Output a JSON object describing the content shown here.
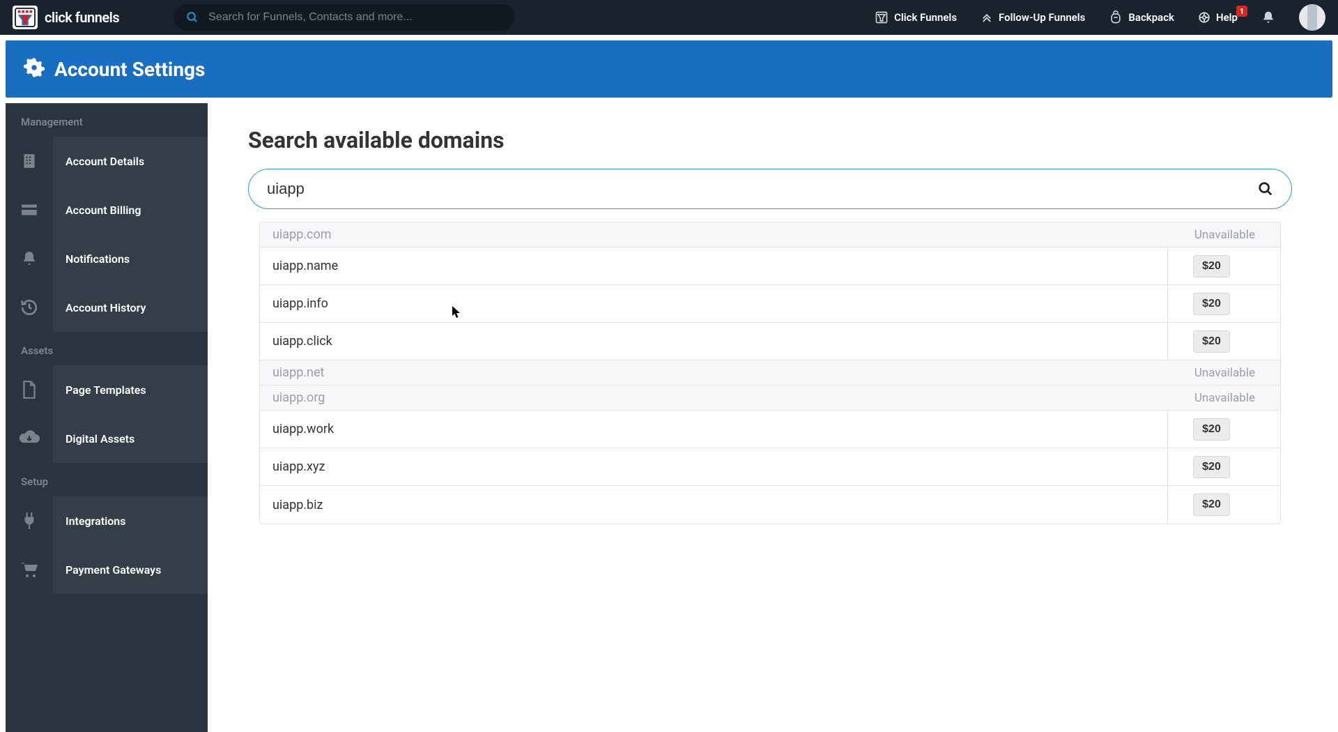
{
  "brand": "click funnels",
  "search_placeholder": "Search for Funnels, Contacts and more...",
  "topnav": [
    {
      "icon": "funnel-icon",
      "label": "Click Funnels"
    },
    {
      "icon": "arrows-up-icon",
      "label": "Follow-Up Funnels"
    },
    {
      "icon": "backpack-icon",
      "label": "Backpack"
    },
    {
      "icon": "help-icon",
      "label": "Help",
      "badge": "1"
    }
  ],
  "page_title": "Account Settings",
  "sidebar": {
    "groups": [
      {
        "title": "Management",
        "items": [
          {
            "icon": "building-icon",
            "label": "Account Details"
          },
          {
            "icon": "card-icon",
            "label": "Account Billing"
          },
          {
            "icon": "bell-icon",
            "label": "Notifications"
          },
          {
            "icon": "history-icon",
            "label": "Account History"
          }
        ]
      },
      {
        "title": "Assets",
        "items": [
          {
            "icon": "page-icon",
            "label": "Page Templates"
          },
          {
            "icon": "cloud-download-icon",
            "label": "Digital Assets"
          }
        ]
      },
      {
        "title": "Setup",
        "items": [
          {
            "icon": "plug-icon",
            "label": "Integrations"
          },
          {
            "icon": "cart-icon",
            "label": "Payment Gateways"
          }
        ]
      }
    ]
  },
  "main": {
    "heading": "Search available domains",
    "query": "uiapp",
    "unavailable_label": "Unavailable",
    "results": [
      {
        "domain": "uiapp.com",
        "available": false
      },
      {
        "domain": "uiapp.name",
        "available": true,
        "price": "$20"
      },
      {
        "domain": "uiapp.info",
        "available": true,
        "price": "$20"
      },
      {
        "domain": "uiapp.click",
        "available": true,
        "price": "$20"
      },
      {
        "domain": "uiapp.net",
        "available": false
      },
      {
        "domain": "uiapp.org",
        "available": false
      },
      {
        "domain": "uiapp.work",
        "available": true,
        "price": "$20"
      },
      {
        "domain": "uiapp.xyz",
        "available": true,
        "price": "$20"
      },
      {
        "domain": "uiapp.biz",
        "available": true,
        "price": "$20"
      }
    ]
  }
}
